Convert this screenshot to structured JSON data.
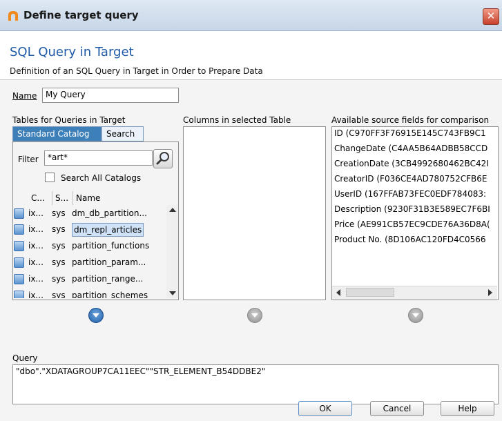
{
  "window": {
    "title": "Define target query",
    "close_glyph": "✕"
  },
  "header": {
    "title": "SQL Query in Target",
    "subtitle": "Definition of an SQL Query in Target in Order to Prepare Data"
  },
  "name_field": {
    "label": "Name",
    "value": "My Query"
  },
  "tables_panel": {
    "label": "Tables for Queries in Target",
    "tabs": [
      {
        "label": "Standard Catalog"
      },
      {
        "label": "Search"
      }
    ],
    "filter_label": "Filter",
    "filter_value": "*art*",
    "search_all_label": "Search All Catalogs",
    "columns": [
      "C...",
      "S...",
      "Name"
    ],
    "rows": [
      {
        "c": "ix...",
        "s": "sys",
        "name": "dm_db_partition..."
      },
      {
        "c": "ix...",
        "s": "sys",
        "name": "dm_repl_articles"
      },
      {
        "c": "ix...",
        "s": "sys",
        "name": "partition_functions"
      },
      {
        "c": "ix...",
        "s": "sys",
        "name": "partition_param..."
      },
      {
        "c": "ix...",
        "s": "sys",
        "name": "partition_range..."
      },
      {
        "c": "ix...",
        "s": "sys",
        "name": "partition_schemes"
      }
    ]
  },
  "columns_panel": {
    "label": "Columns in selected Table"
  },
  "source_panel": {
    "label": "Available source fields for comparison",
    "items": [
      "ID (C970FF3F76915E145C743FB9C1",
      "ChangeDate (C4AA5B64ADBB58CCD",
      "CreationDate (3CB4992680462BC42I",
      "CreatorID (F036CE4AD780752CFB6E",
      "UserID (167FFAB73FEC0EDF784083:",
      "Description (9230F31B3E589EC7F6BI",
      "Price (AE991CB57EC9CDE76A36D8A(",
      "Product No. (8D106AC120FD4C0566"
    ]
  },
  "query": {
    "label": "Query",
    "value": "\"dbo\".\"XDATAGROUP7CA11EEC\"\"STR_ELEMENT_B54DDBE2\""
  },
  "buttons": {
    "ok": "OK",
    "cancel": "Cancel",
    "help": "Help"
  }
}
